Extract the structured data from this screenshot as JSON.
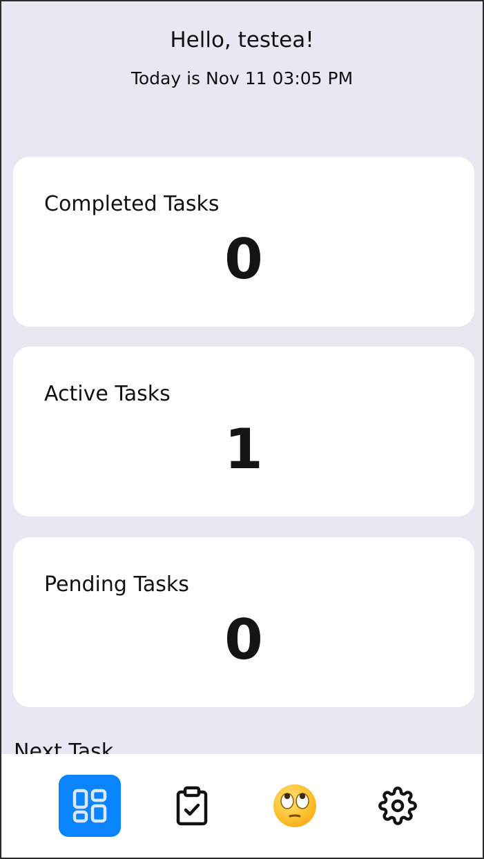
{
  "header": {
    "greeting": "Hello, testea!",
    "date_line": "Today is Nov 11 03:05 PM"
  },
  "stats": [
    {
      "label": "Completed Tasks",
      "value": "0"
    },
    {
      "label": "Active Tasks",
      "value": "1"
    },
    {
      "label": "Pending Tasks",
      "value": "0"
    }
  ],
  "next_task": {
    "heading": "Next Task"
  },
  "nav": {
    "items": [
      {
        "icon": "dashboard-icon",
        "active": true
      },
      {
        "icon": "clipboard-check-icon",
        "active": false
      },
      {
        "icon": "eye-roll-emoji-icon",
        "active": false
      },
      {
        "icon": "gear-icon",
        "active": false
      }
    ]
  },
  "colors": {
    "background": "#e9e7f2",
    "card": "#ffffff",
    "accent": "#0a84ff",
    "text": "#111111"
  }
}
